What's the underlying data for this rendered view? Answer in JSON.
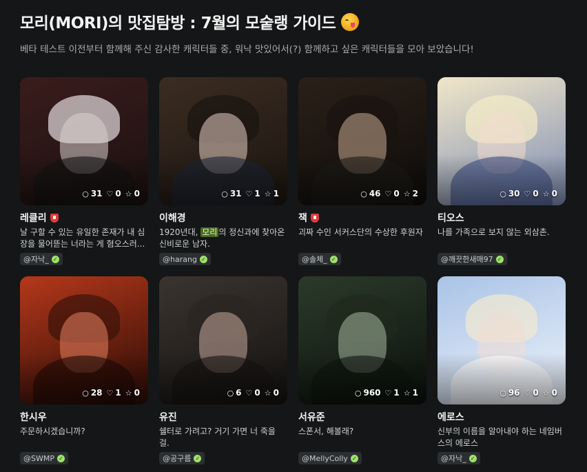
{
  "header": {
    "title": "모리(MORI)의 맛집탐방 : 7월의 모숱랭 가이드",
    "emoji": "yum-face-emoji",
    "subtitle": "베타 테스트 이전부터 함께해 주신 감사한 캐릭터들 중, 워낙 맛있어서(?) 함께하고 싶은 캐릭터들을 모아 보았습니다!"
  },
  "colors": {
    "background": "#141617",
    "badge_red": "#e03b3b",
    "verified_green": "#9ee26a",
    "highlight_green": "#4a6b21"
  },
  "characters": [
    {
      "name": "레클리",
      "restricted": true,
      "desc": "날 구할 수 있는 유일한 존재가 내 심장을 물어뜯는 너라는 게 혐오스러...",
      "creator": "@자낙_",
      "comments": "31",
      "likes": "0",
      "stars": "0",
      "theme": [
        "#3a1c1c",
        "#1b1010",
        "#d9d2d0",
        "#e6dde0",
        "#121212"
      ]
    },
    {
      "name": "이해경",
      "restricted": false,
      "desc_pre": "1920년대, ",
      "desc_hl": "모리",
      "desc_post": "의 정신과에 찾아온 신비로운 남자.",
      "creator": "@harang",
      "comments": "31",
      "likes": "1",
      "stars": "1",
      "theme": [
        "#3b2c22",
        "#1b1510",
        "#e6d0c3",
        "#1a1410",
        "#1c2535"
      ]
    },
    {
      "name": "잭",
      "restricted": true,
      "desc": "괴짜 수인 서커스단의 수상한 후원자",
      "creator": "@솔체_",
      "comments": "46",
      "likes": "0",
      "stars": "2",
      "theme": [
        "#2a2018",
        "#0f0c0a",
        "#c9a98f",
        "#1a130f",
        "#1d1a18"
      ]
    },
    {
      "name": "티오스",
      "restricted": false,
      "desc": "나를 가족으로 보지 않는 외삼촌.",
      "creator": "@깨끗한새매97",
      "comments": "30",
      "likes": "0",
      "stars": "0",
      "theme": [
        "#f1e6c8",
        "#7d8db4",
        "#f3dccd",
        "#f7edc7",
        "#3d4f86"
      ]
    },
    {
      "name": "한시우",
      "restricted": false,
      "desc": "주문하시겠습니까?",
      "creator": "@SWMP",
      "comments": "28",
      "likes": "1",
      "stars": "0",
      "theme": [
        "#b5381a",
        "#2a0b06",
        "#e48260",
        "#3a120a",
        "#1c0905"
      ]
    },
    {
      "name": "유진",
      "restricted": false,
      "desc": "쉘터로 가려고? 거기 가면 너 죽을 걸.",
      "creator": "@공구름",
      "comments": "6",
      "likes": "0",
      "stars": "0",
      "theme": [
        "#3a3430",
        "#141210",
        "#c7aa9c",
        "#2b2522",
        "#151311"
      ]
    },
    {
      "name": "서유준",
      "restricted": false,
      "desc": "스폰서, 해볼래?",
      "creator": "@MellyColly",
      "comments": "960",
      "likes": "1",
      "stars": "1",
      "theme": [
        "#2b3a2a",
        "#0b110c",
        "#a6b6a0",
        "#1f2a1c",
        "#0d140e"
      ]
    },
    {
      "name": "에로스",
      "restricted": false,
      "desc": "신부의 이름을 알아내야 하는 네임버스의 에로스",
      "creator": "@자낙_",
      "comments": "96",
      "likes": "0",
      "stars": "0",
      "theme": [
        "#a9c3e6",
        "#eef3fb",
        "#f1ddd2",
        "#f3ead2",
        "#ffffff"
      ]
    }
  ]
}
